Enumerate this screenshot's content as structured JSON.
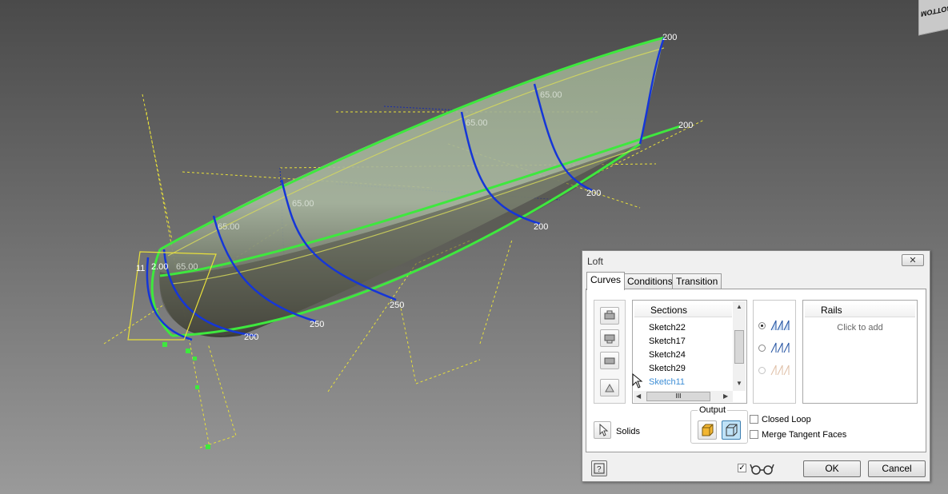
{
  "viewcube": {
    "face_label": "BOTTOM"
  },
  "viewport": {
    "dimensions": [
      "200",
      "200",
      "200",
      "200",
      "250",
      "250",
      "200",
      "65.00",
      "65.00",
      "65.00",
      "65.00",
      "65.00",
      "11",
      "2.00"
    ]
  },
  "dialog": {
    "title": "Loft",
    "close_icon": "close-icon",
    "tabs": [
      {
        "label": "Curves",
        "active": true
      },
      {
        "label": "Conditions",
        "active": false
      },
      {
        "label": "Transition",
        "active": false
      }
    ],
    "sections": {
      "header": "Sections",
      "items": [
        "Sketch22",
        "Sketch17",
        "Sketch24",
        "Sketch29",
        "Sketch11"
      ],
      "selected_index": 4,
      "scroll_thumb": "III"
    },
    "rails": {
      "header": "Rails",
      "hint": "Click to add"
    },
    "solids_label": "Solids",
    "output_label": "Output",
    "closed_loop_label": "Closed Loop",
    "merge_tangent_faces_label": "Merge Tangent Faces",
    "ok_label": "OK",
    "cancel_label": "Cancel",
    "preview_checked": true
  },
  "colors": {
    "section_curve": "#1536d8",
    "profile_edge": "#3ee83e",
    "construction": "#e8e03a",
    "surface": "#8fa686"
  }
}
